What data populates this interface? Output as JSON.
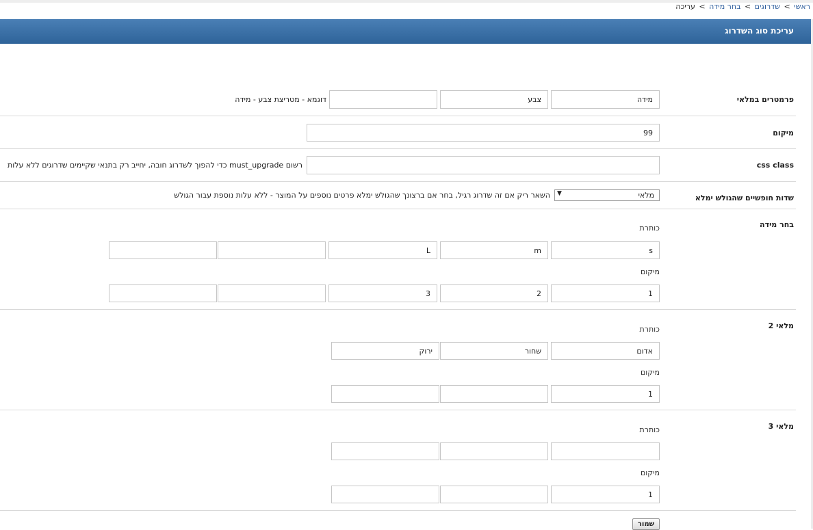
{
  "breadcrumbs": [
    {
      "label": "ראשי",
      "link": true
    },
    {
      "label": "שדרוגים",
      "link": true
    },
    {
      "label": "בחר מידה",
      "link": true
    },
    {
      "label": "עריכה",
      "link": false
    }
  ],
  "breadcrumb_separator": ">",
  "header": {
    "title": "עריכת סוג השדרוג"
  },
  "params": {
    "label": "פרמטרים במלאי",
    "fields": [
      "מידה",
      "צבע",
      ""
    ],
    "example_note": "דוגמא - מטריצת צבע - מידה"
  },
  "position": {
    "label": "מיקום",
    "value": "99"
  },
  "css_class": {
    "label": "css class",
    "value": "",
    "note": "רשום must_upgrade כדי להפוך לשדרוג חובה, יחייב רק בתנאי שקיימים שדרוגים ללא עלות"
  },
  "free_fields": {
    "label": "שדות חופשיים שהגולש ימלא",
    "selected": "מלאי",
    "arrow": "▼",
    "note": "השאר ריק אם זה שדרוג רגיל, בחר אם ברצונך שהגולש ימלא פרטים נוספים על המוצר - ללא עלות נוספת עבור הגולש"
  },
  "sections": [
    {
      "label": "בחר מידה",
      "title_label": "כותרת",
      "titles": [
        "s",
        "m",
        "L",
        "",
        ""
      ],
      "position_label": "מיקום",
      "positions": [
        "1",
        "2",
        "3",
        "",
        ""
      ]
    },
    {
      "label": "מלאי 2",
      "title_label": "כותרת",
      "titles": [
        "אדום",
        "שחור",
        "ירוק"
      ],
      "position_label": "מיקום",
      "positions": [
        "1",
        "",
        ""
      ]
    },
    {
      "label": "מלאי 3",
      "title_label": "כותרת",
      "titles": [
        "",
        "",
        ""
      ],
      "position_label": "מיקום",
      "positions": [
        "1",
        "",
        ""
      ]
    }
  ],
  "save_button": "שמור"
}
